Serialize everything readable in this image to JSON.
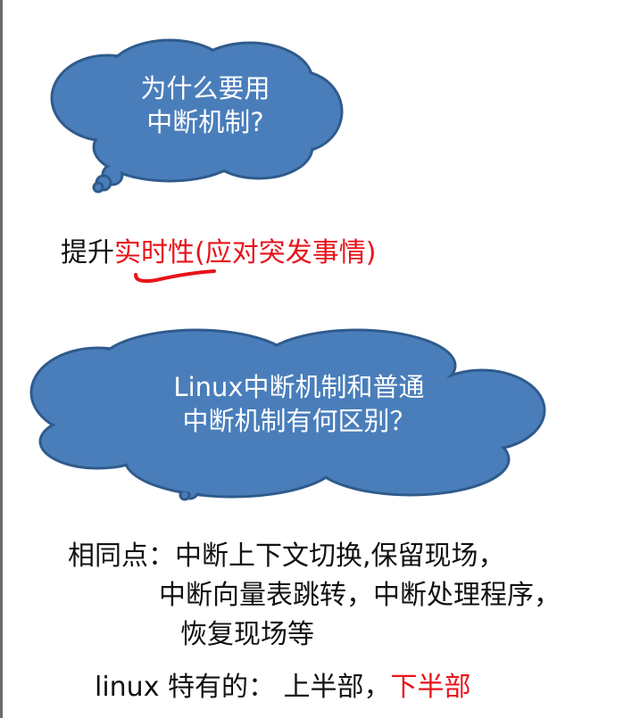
{
  "cloud1": {
    "line1": "为什么要用",
    "line2": "中断机制?"
  },
  "answer1": {
    "prefix": "提升",
    "highlight": "实时性",
    "suffix": "(应对突发事情)"
  },
  "cloud2": {
    "line1": "Linux中断机制和普通",
    "line2": "中断机制有何区别？"
  },
  "same": {
    "line1": "相同点：中断上下文切换,保留现场，",
    "line2": "中断向量表跳转，中断处理程序，",
    "line3": "恢复现场等"
  },
  "linux": {
    "prefix": "linux 特有的： 上半部，",
    "highlight": "下半部"
  },
  "colors": {
    "cloud_fill": "#4a7ebb",
    "cloud_stroke": "#2f5b8c",
    "highlight": "#e8141a"
  }
}
